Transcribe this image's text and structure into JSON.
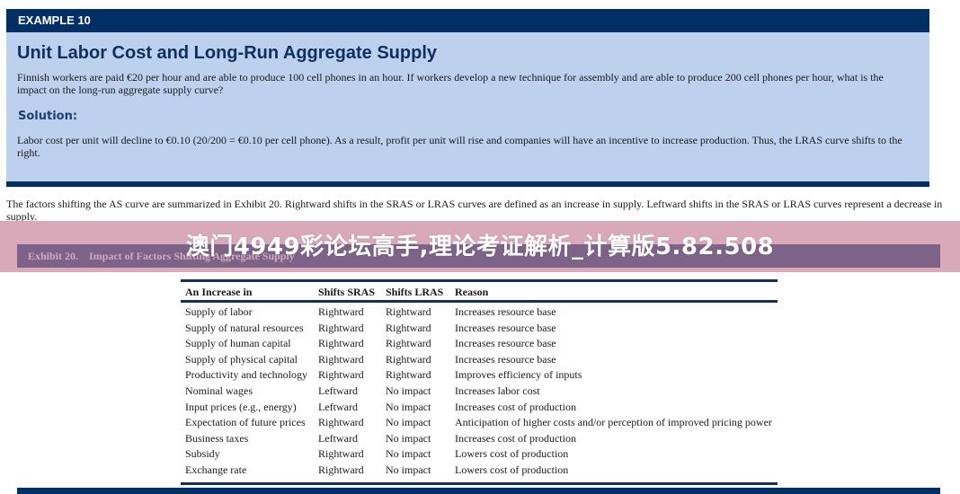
{
  "example": {
    "label": "EXAMPLE 10",
    "title": "Unit Labor Cost and Long-Run Aggregate Supply",
    "question": "Finnish workers are paid €20 per hour and are able to produce 100 cell phones in an hour. If workers develop a new technique for assembly and are able to produce 200 cell phones per hour, what is the impact on the long-run aggregate supply curve?",
    "solution_label": "Solution:",
    "solution_text": "Labor cost per unit will decline to €0.10 (20/200 = €0.10 per cell phone). As a result, profit per unit will rise and companies will have an incentive to increase production. Thus, the LRAS curve shifts to the right."
  },
  "intro_text": "The factors shifting the AS curve are summarized in Exhibit 20. Rightward shifts in the SRAS or LRAS curves are defined as an increase in supply. Leftward shifts in the SRAS or LRAS curves represent a decrease in supply.",
  "overlay": {
    "text": "澳门4949彩论坛高手,理论考证解析_计算版5.82.508"
  },
  "exhibit": {
    "title": "Exhibit 20.    Impact of Factors Shifting Aggregate Supply",
    "headers": [
      "An Increase in",
      "Shifts SRAS",
      "Shifts LRAS",
      "Reason"
    ],
    "rows": [
      [
        "Supply of labor",
        "Rightward",
        "Rightward",
        "Increases resource base"
      ],
      [
        "Supply of natural resources",
        "Rightward",
        "Rightward",
        "Increases resource base"
      ],
      [
        "Supply of human capital",
        "Rightward",
        "Rightward",
        "Increases resource base"
      ],
      [
        "Supply of physical capital",
        "Rightward",
        "Rightward",
        "Increases resource base"
      ],
      [
        "Productivity and technology",
        "Rightward",
        "Rightward",
        "Improves efficiency of inputs"
      ],
      [
        "Nominal wages",
        "Leftward",
        "No impact",
        "Increases labor cost"
      ],
      [
        "Input prices (e.g., energy)",
        "Leftward",
        "No impact",
        "Increases cost of production"
      ],
      [
        "Expectation of future prices",
        "Rightward",
        "No impact",
        "Anticipation of higher costs and/or perception of improved pricing power"
      ],
      [
        "Business taxes",
        "Leftward",
        "No impact",
        "Increases cost of production"
      ],
      [
        "Subsidy",
        "Rightward",
        "No impact",
        "Lowers cost of production"
      ],
      [
        "Exchange rate",
        "Rightward",
        "No impact",
        "Lowers cost of production"
      ]
    ]
  },
  "colors": {
    "header_navy": "#002f66",
    "example_background": "#bdd0ee",
    "overlay_band": "#d9a9ba",
    "exhibit_bar": "#7d6388"
  }
}
